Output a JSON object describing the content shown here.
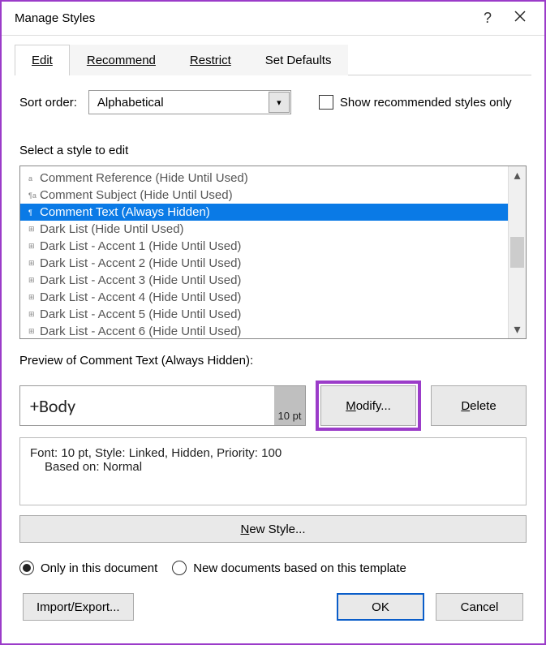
{
  "window": {
    "title": "Manage Styles"
  },
  "tabs": {
    "edit": "Edit",
    "recommend": "Recommend",
    "restrict": "Restrict",
    "defaults": "Set Defaults"
  },
  "sort": {
    "label": "Sort order:",
    "value": "Alphabetical"
  },
  "show_recommended_label": "Show recommended styles only",
  "select_label": "Select a style to edit",
  "styles": [
    {
      "name": "Comment Reference",
      "state": "(Hide Until Used)",
      "icon": "a",
      "selected": false
    },
    {
      "name": "Comment Subject",
      "state": "(Hide Until Used)",
      "icon": "¶a",
      "selected": false
    },
    {
      "name": "Comment Text",
      "state": "(Always Hidden)",
      "icon": "¶",
      "selected": true
    },
    {
      "name": "Dark List",
      "state": "(Hide Until Used)",
      "icon": "⊞",
      "selected": false
    },
    {
      "name": "Dark List - Accent 1",
      "state": "(Hide Until Used)",
      "icon": "⊞",
      "selected": false
    },
    {
      "name": "Dark List - Accent 2",
      "state": "(Hide Until Used)",
      "icon": "⊞",
      "selected": false
    },
    {
      "name": "Dark List - Accent 3",
      "state": "(Hide Until Used)",
      "icon": "⊞",
      "selected": false
    },
    {
      "name": "Dark List - Accent 4",
      "state": "(Hide Until Used)",
      "icon": "⊞",
      "selected": false
    },
    {
      "name": "Dark List - Accent 5",
      "state": "(Hide Until Used)",
      "icon": "⊞",
      "selected": false
    },
    {
      "name": "Dark List - Accent 6",
      "state": "(Hide Until Used)",
      "icon": "⊞",
      "selected": false
    }
  ],
  "preview": {
    "label": "Preview of Comment Text  (Always Hidden):",
    "sample": "+Body",
    "size": "10 pt"
  },
  "buttons": {
    "modify": "Modify...",
    "delete": "Delete",
    "new_style": "New Style...",
    "import_export": "Import/Export...",
    "ok": "OK",
    "cancel": "Cancel"
  },
  "description": {
    "line1": "Font: 10 pt, Style: Linked, Hidden, Priority: 100",
    "line2": "Based on: Normal"
  },
  "radios": {
    "only_doc": "Only in this document",
    "new_docs": "New documents based on this template"
  }
}
